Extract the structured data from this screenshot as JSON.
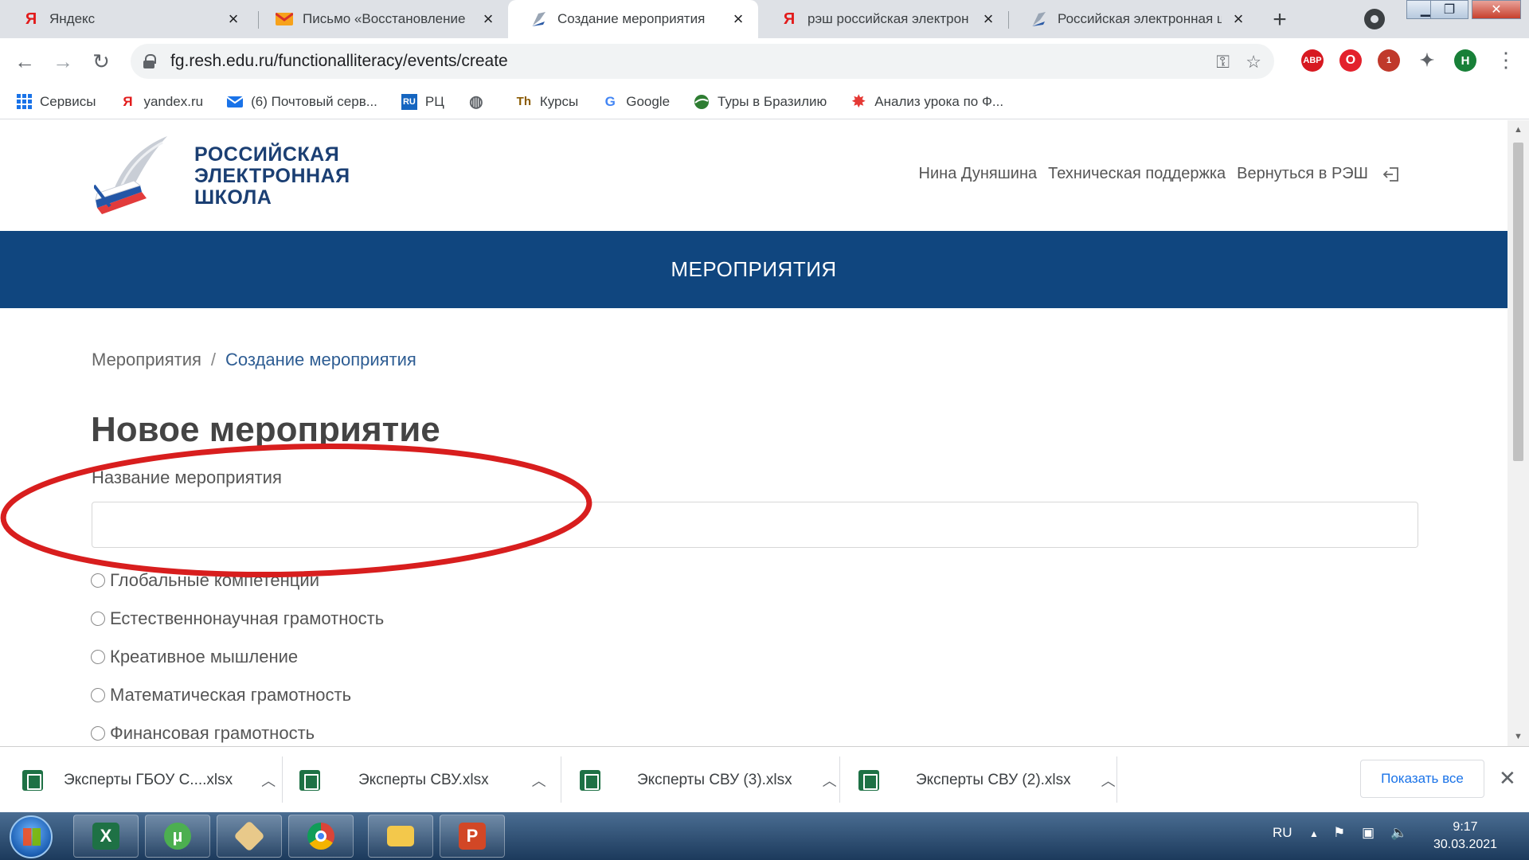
{
  "browser": {
    "tabs": [
      {
        "title": "Яндекс",
        "icon": "yandex-icon",
        "active": false
      },
      {
        "title": "Письмо «Восстановление",
        "icon": "mail-icon",
        "active": false
      },
      {
        "title": "Создание мероприятия",
        "icon": "resh-icon",
        "active": true
      },
      {
        "title": "рэш российская электрон",
        "icon": "yandex-icon",
        "active": false
      },
      {
        "title": "Российская электронная ш",
        "icon": "resh-icon",
        "active": false
      }
    ],
    "url": "fg.resh.edu.ru/functionalliteracy/events/create",
    "bookmarks": [
      {
        "label": "Сервисы",
        "icon": "apps-icon"
      },
      {
        "label": "yandex.ru",
        "icon": "yandex-icon"
      },
      {
        "label": "(6) Почтовый серв...",
        "icon": "mail-icon"
      },
      {
        "label": "РЦ",
        "icon": "ru-icon"
      },
      {
        "label": "",
        "icon": "globe-icon"
      },
      {
        "label": "Курсы",
        "icon": "courses-icon"
      },
      {
        "label": "Google",
        "icon": "google-icon"
      },
      {
        "label": "Туры в Бразилию",
        "icon": "travel-icon"
      },
      {
        "label": "Анализ урока по Ф...",
        "icon": "star-icon"
      }
    ],
    "extensions": [
      {
        "label": "ABP",
        "color": "#d71921"
      },
      {
        "label": "O",
        "color": "#e3212c"
      },
      {
        "label": "1",
        "color": "#c0392b"
      },
      {
        "label": "H",
        "color": "#188038"
      }
    ]
  },
  "site": {
    "logo_lines": [
      "РОССИЙСКАЯ",
      "ЭЛЕКТРОННАЯ",
      "ШКОЛА"
    ],
    "user_name": "Нина Дуняшина",
    "support_link": "Техническая поддержка",
    "back_link": "Вернуться в РЭШ",
    "banner": "МЕРОПРИЯТИЯ",
    "brand_color": "#10467f"
  },
  "breadcrumb": {
    "root": "Мероприятия",
    "separator": "/",
    "current": "Создание мероприятия"
  },
  "form": {
    "title": "Новое мероприятие",
    "name_label": "Название мероприятия",
    "name_value": "",
    "options": [
      "Глобальные компетенции",
      "Естественнонаучная грамотность",
      "Креативное мышление",
      "Математическая грамотность",
      "Финансовая грамотность"
    ]
  },
  "downloads": {
    "items": [
      "Эксперты ГБОУ С....xlsx",
      "Эксперты СВУ.xlsx",
      "Эксперты СВУ (3).xlsx",
      "Эксперты СВУ (2).xlsx"
    ],
    "show_all": "Показать все"
  },
  "taskbar": {
    "language": "RU",
    "time": "9:17",
    "date": "30.03.2021"
  }
}
